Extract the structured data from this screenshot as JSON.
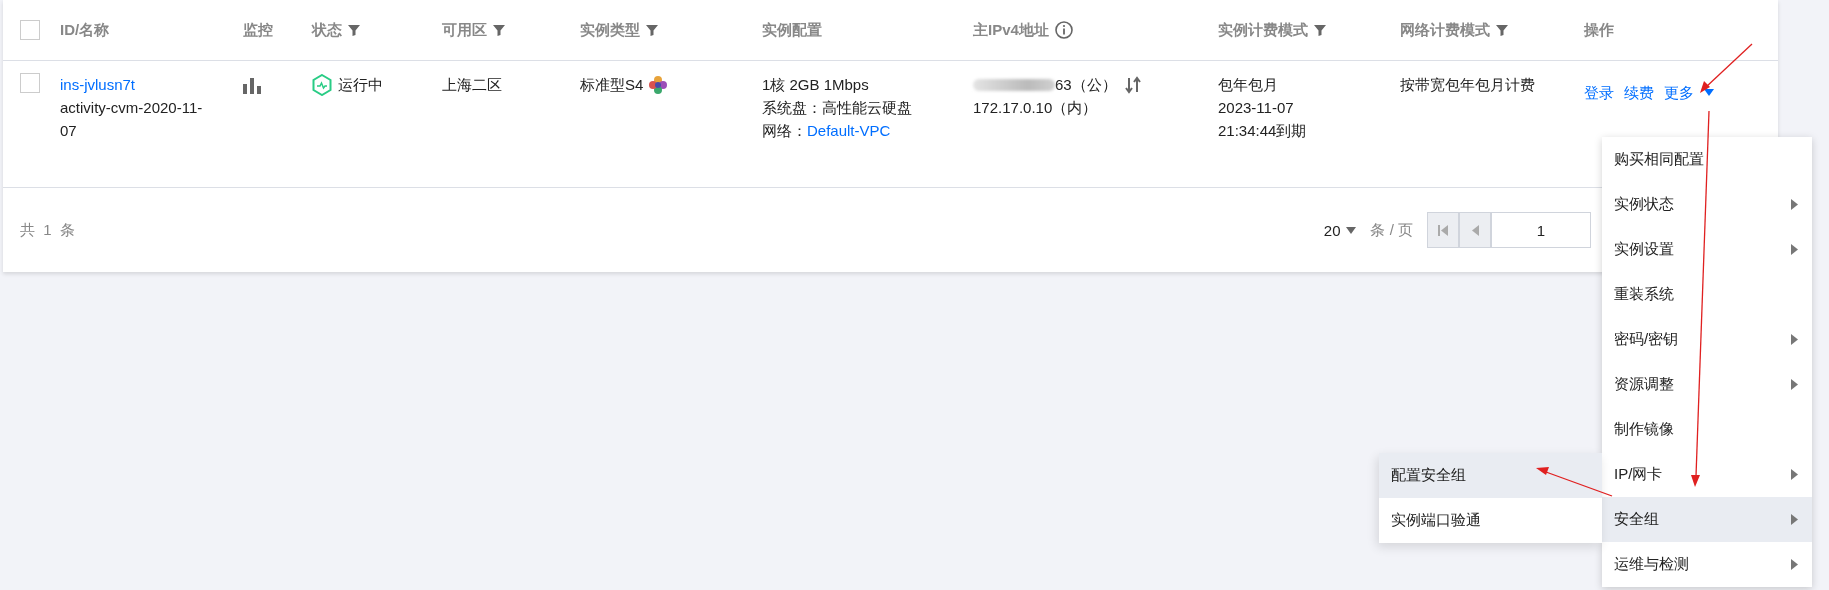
{
  "table": {
    "select_all": {
      "checked": false
    },
    "columns": [
      {
        "label": "ID/名称",
        "kind": "plain"
      },
      {
        "label": "监控",
        "kind": "plain"
      },
      {
        "label": "状态",
        "kind": "filter"
      },
      {
        "label": "可用区",
        "kind": "filter"
      },
      {
        "label": "实例类型",
        "kind": "filter"
      },
      {
        "label": "实例配置",
        "kind": "plain"
      },
      {
        "label": "主IPv4地址",
        "kind": "info"
      },
      {
        "label": "实例计费模式",
        "kind": "filter"
      },
      {
        "label": "网络计费模式",
        "kind": "filter"
      },
      {
        "label": "操作",
        "kind": "plain"
      }
    ],
    "rows": [
      {
        "checked": false,
        "id": "ins-jvlusn7t",
        "name": "activity-cvm-2020-11-07",
        "status": "运行中",
        "zone": "上海二区",
        "type": "标准型S4",
        "config": "1核 2GB 1Mbps",
        "disk": "系统盘：高性能云硬盘",
        "network_label": "网络：",
        "network_link": "Default-VPC",
        "ip_public": "63（公）",
        "ip_private": "172.17.0.10（内）",
        "billing": "包年包月",
        "expiry": "2023-11-07 21:34:44到期",
        "network_billing": "按带宽包年包月计费",
        "actions": [
          "登录",
          "续费"
        ],
        "more": "更多"
      }
    ]
  },
  "footer": {
    "total": "共 1 条",
    "page_size": "20",
    "page_unit": "条 / 页",
    "page": "1"
  },
  "menu": {
    "items": [
      {
        "label": "购买相同配置",
        "kind": "action",
        "selected": false
      },
      {
        "label": "实例状态",
        "kind": "submenu",
        "selected": false
      },
      {
        "label": "实例设置",
        "kind": "submenu",
        "selected": false
      },
      {
        "label": "重装系统",
        "kind": "action",
        "selected": false
      },
      {
        "label": "密码/密钥",
        "kind": "submenu",
        "selected": false
      },
      {
        "label": "资源调整",
        "kind": "submenu",
        "selected": false
      },
      {
        "label": "制作镜像",
        "kind": "action",
        "selected": false
      },
      {
        "label": "IP/网卡",
        "kind": "submenu",
        "selected": false
      },
      {
        "label": "安全组",
        "kind": "submenu",
        "selected": true
      },
      {
        "label": "运维与检测",
        "kind": "submenu",
        "selected": false
      }
    ],
    "submenu": [
      {
        "label": "配置安全组",
        "selected": true
      },
      {
        "label": "实例端口验通",
        "selected": false
      }
    ]
  }
}
